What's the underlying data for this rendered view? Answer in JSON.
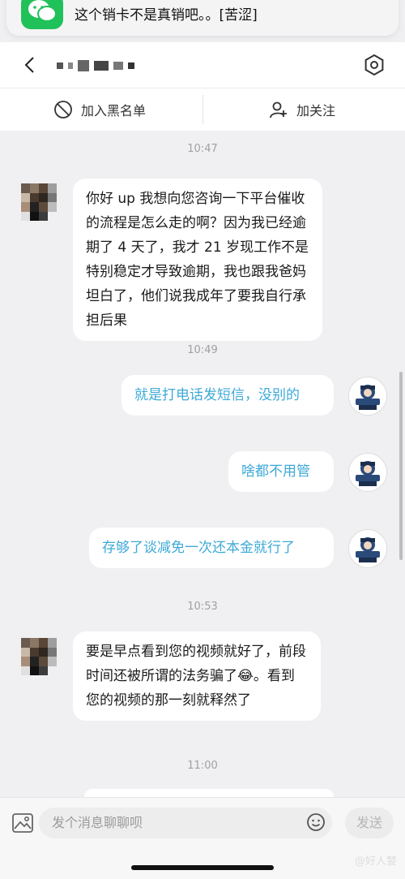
{
  "notification": {
    "message": "这个销卡不是真销吧。。[苦涩]",
    "app_icon": "wechat-icon"
  },
  "header": {
    "back_icon": "back-icon",
    "settings_icon": "settings-icon"
  },
  "actions": {
    "block_label": "加入黑名单",
    "follow_label": "加关注"
  },
  "chat": {
    "times": [
      "10:47",
      "10:49",
      "10:53",
      "11:00"
    ],
    "messages": [
      {
        "side": "left",
        "text": "你好 up 我想向您咨询一下平台催收的流程是怎么走的啊？因为我已经逾期了 4 天了，我才 21 岁现工作不是特别稳定才导致逾期，我也跟我爸妈坦白了，他们说我成年了要我自行承担后果"
      },
      {
        "side": "right",
        "text": "就是打电话发短信，没别的"
      },
      {
        "side": "right",
        "text": "啥都不用管"
      },
      {
        "side": "right",
        "text": "存够了谈减免一次还本金就行了"
      },
      {
        "side": "left",
        "text_a": "要是早点看到您的视频就好了，前段时间还被所谓的法务骗了",
        "emoji": "😂",
        "text_b": "。看到您的视频的那一刻就释然了"
      }
    ]
  },
  "input": {
    "placeholder": "发个消息聊聊呗",
    "send_label": "发送"
  },
  "watermark": "@好人婪",
  "colors": {
    "mine_text": "#3ea9d8",
    "wechat_green": "#21c15a"
  }
}
